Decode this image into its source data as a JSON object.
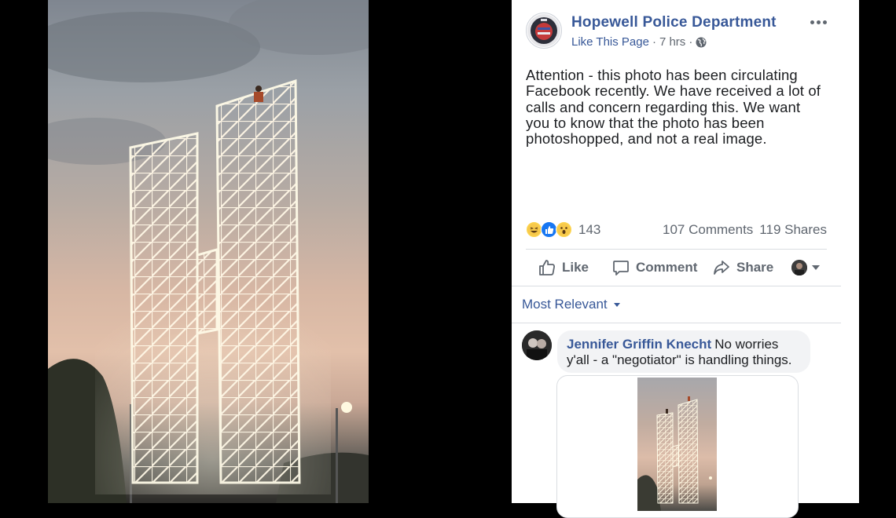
{
  "post": {
    "page_name": "Hopewell Police Department",
    "like_page": "Like This Page",
    "separator": "·",
    "time": "7 hrs",
    "text": "Attention - this photo has been circulating Facebook recently. We have received a lot of calls and concern regarding this. We want you to know that the photo has been photoshopped, and not a real image."
  },
  "stats": {
    "reaction_count": "143",
    "comments": "107 Comments",
    "shares": "119 Shares"
  },
  "actions": {
    "like": "Like",
    "comment": "Comment",
    "share": "Share"
  },
  "comments_section": {
    "sort_label": "Most Relevant",
    "comment": {
      "author": "Jennifer Griffin Knecht",
      "text": "No worries y'all - a \"negotiator\" is handling things."
    }
  },
  "colors": {
    "link_blue": "#385898",
    "meta_gray": "#606770",
    "background": "#000000"
  },
  "icons": [
    "more-icon",
    "globe-icon",
    "haha-reaction-icon",
    "like-reaction-icon",
    "wow-reaction-icon",
    "thumbs-up-icon",
    "comment-icon",
    "share-icon",
    "caret-down-icon"
  ]
}
